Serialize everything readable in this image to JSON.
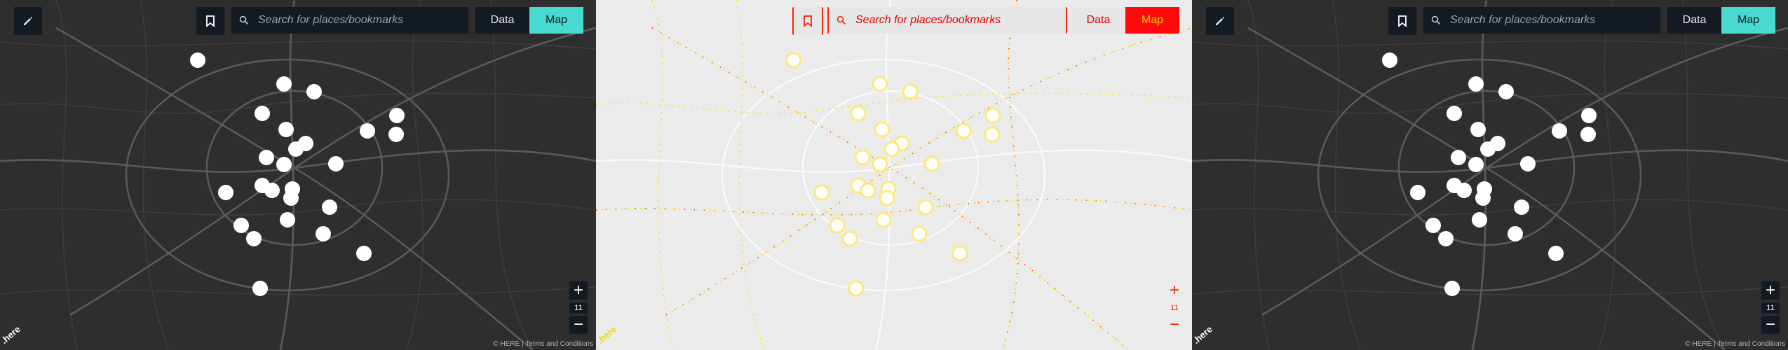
{
  "search": {
    "placeholder": "Search for places/bookmarks"
  },
  "toggle": {
    "data_label": "Data",
    "map_label": "Map",
    "active": "Map"
  },
  "zoom": {
    "level": "11",
    "plus": "+",
    "minus": "−"
  },
  "footer": {
    "copyright": "© HERE | Terms and Conditions",
    "logo": ".here"
  },
  "icons": {
    "edit": "pencil-icon",
    "bookmark": "bookmark-icon",
    "search": "search-icon"
  },
  "colors": {
    "accent": "#48dad0",
    "toolbar": "#131a22",
    "map_dark": "#2e2e2e",
    "map_light": "#ebebeb",
    "marker": "#ffffff"
  }
}
